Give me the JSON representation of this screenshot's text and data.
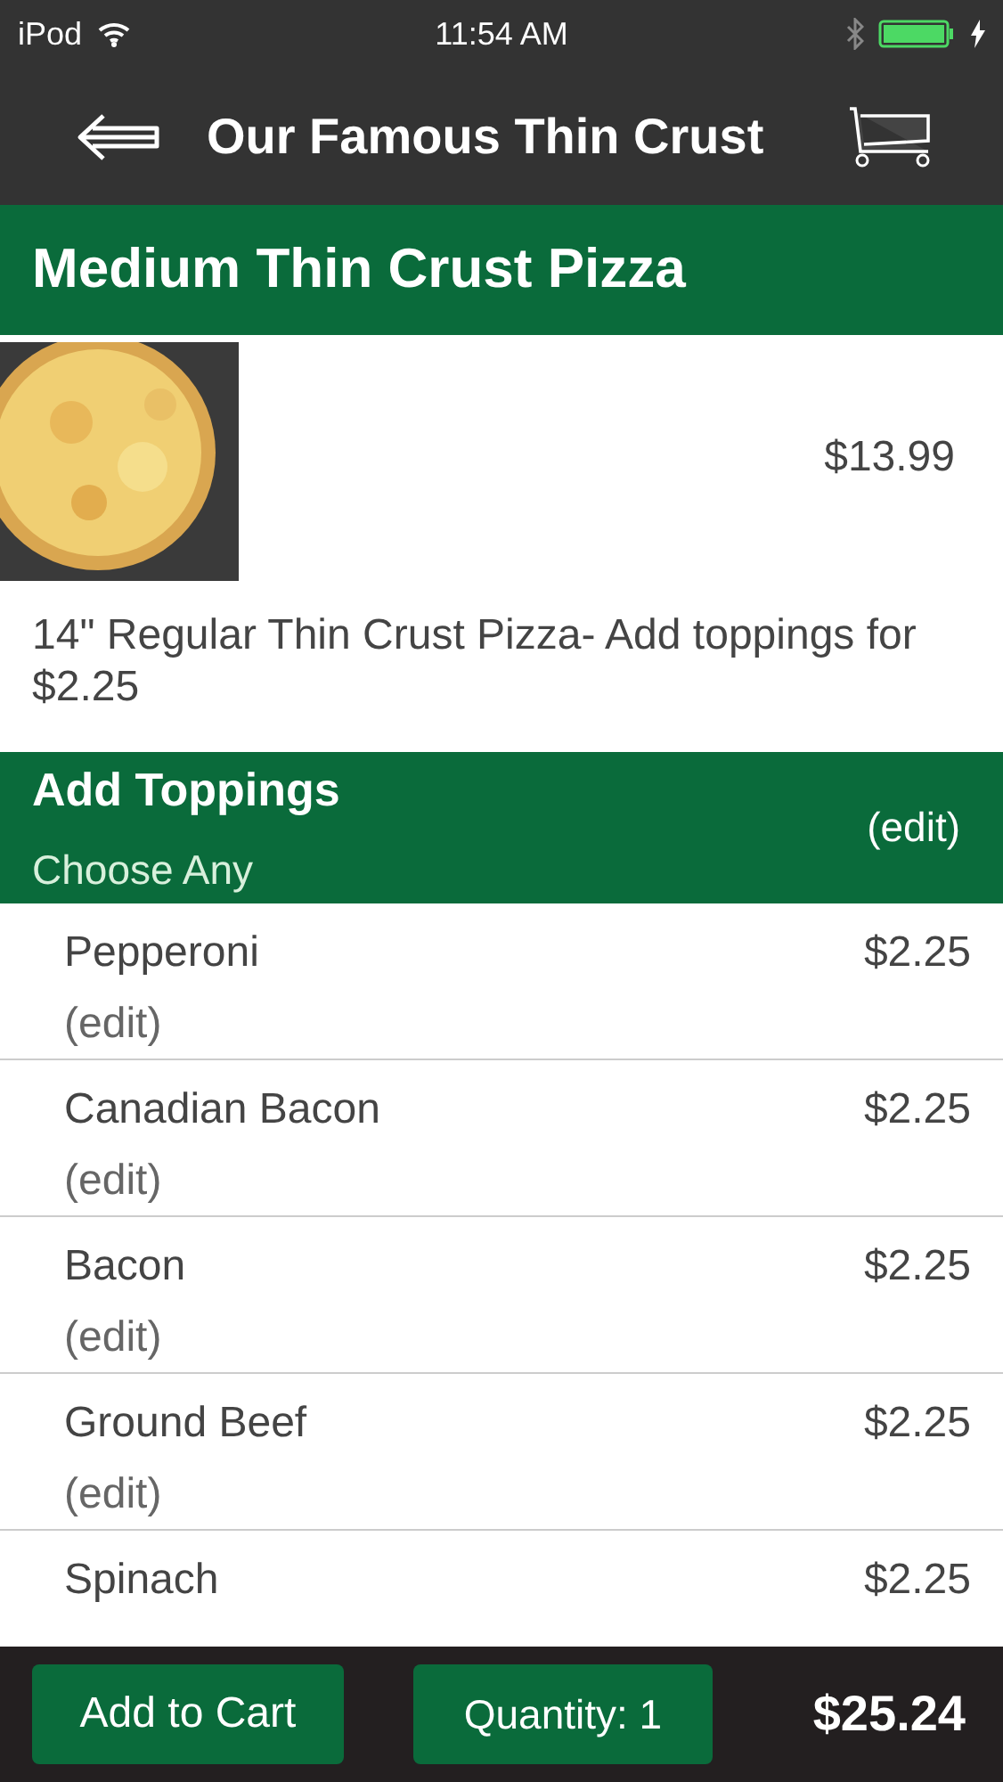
{
  "status_bar": {
    "carrier": "iPod",
    "time": "11:54 AM"
  },
  "nav": {
    "title": "Our Famous Thin Crust"
  },
  "item": {
    "title": "Medium Thin Crust Pizza",
    "price": "$13.99",
    "description": "14\" Regular Thin Crust Pizza- Add toppings for $2.25"
  },
  "toppings": {
    "title": "Add Toppings",
    "subtitle": "Choose Any",
    "edit": "(edit)",
    "items": [
      {
        "name": "Pepperoni",
        "edit": "(edit)",
        "price": "$2.25"
      },
      {
        "name": "Canadian Bacon",
        "edit": "(edit)",
        "price": "$2.25"
      },
      {
        "name": "Bacon",
        "edit": "(edit)",
        "price": "$2.25"
      },
      {
        "name": "Ground Beef",
        "edit": "(edit)",
        "price": "$2.25"
      },
      {
        "name": "Spinach",
        "price": "$2.25"
      }
    ]
  },
  "footer": {
    "add_button": "Add to Cart",
    "quantity_button": "Quantity: 1",
    "total": "$25.24"
  }
}
